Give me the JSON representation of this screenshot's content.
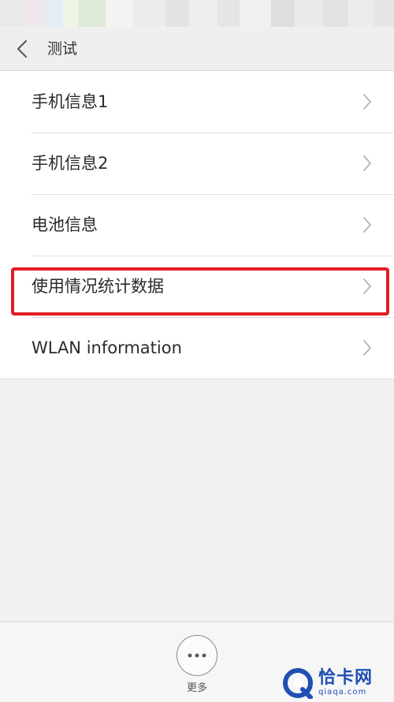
{
  "header": {
    "title": "测试",
    "back_icon": "chevron-left-icon"
  },
  "list": {
    "items": [
      {
        "label": "手机信息1",
        "icon": "chevron-right-icon",
        "highlighted": false
      },
      {
        "label": "手机信息2",
        "icon": "chevron-right-icon",
        "highlighted": false
      },
      {
        "label": "电池信息",
        "icon": "chevron-right-icon",
        "highlighted": false
      },
      {
        "label": "使用情况统计数据",
        "icon": "chevron-right-icon",
        "highlighted": true
      },
      {
        "label": "WLAN information",
        "icon": "chevron-right-icon",
        "highlighted": false
      }
    ]
  },
  "bottom": {
    "more_label": "更多",
    "more_icon": "more-dots-icon"
  },
  "watermark": {
    "name": "恰卡网",
    "domain": "qiaqa.com"
  },
  "colors": {
    "highlight": "#e41d24",
    "background": "#f1f1f1",
    "list_background": "#ffffff",
    "watermark": "#1f4fb4"
  }
}
